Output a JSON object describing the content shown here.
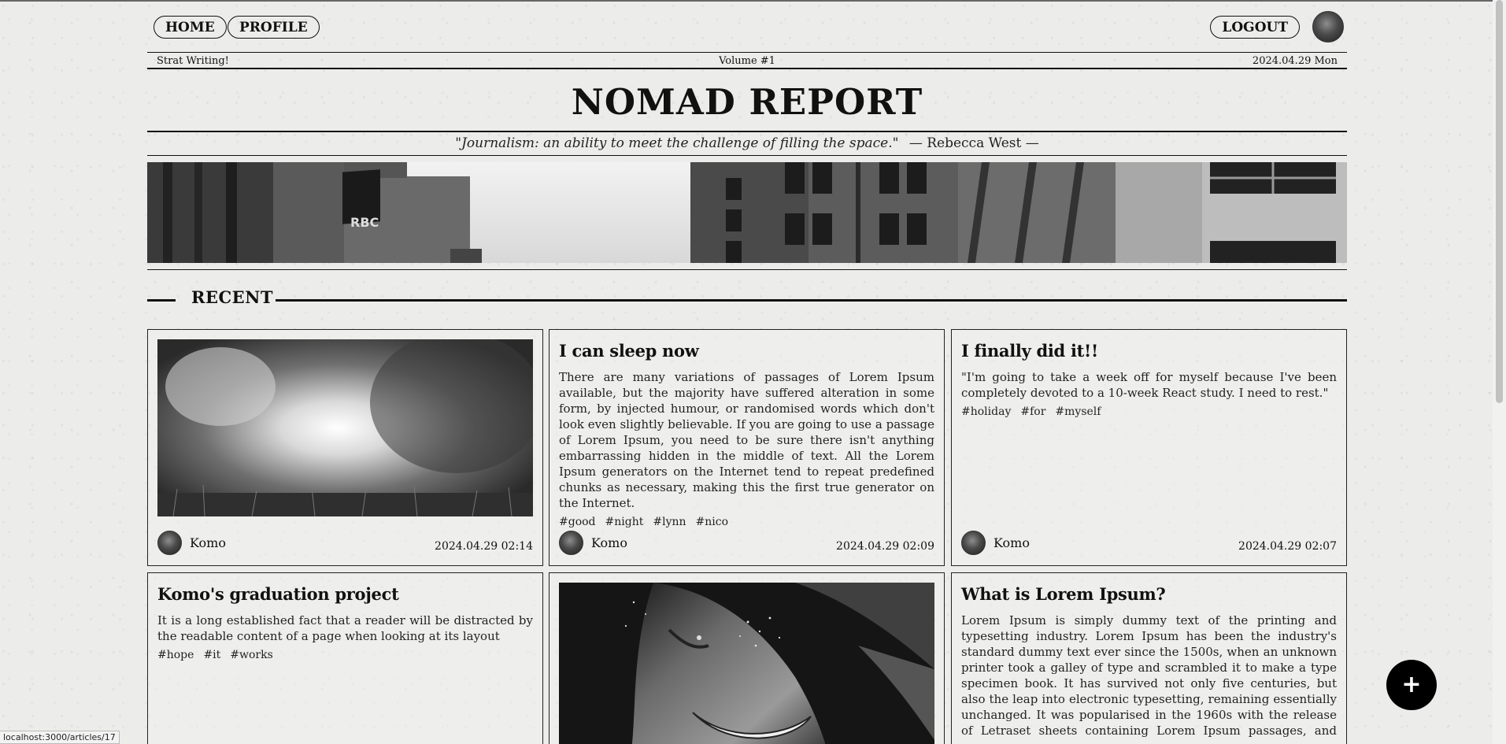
{
  "nav": {
    "home_label": "HOME",
    "profile_label": "PROFILE",
    "logout_label": "LOGOUT"
  },
  "infobar": {
    "left": "Strat Writing!",
    "center": "Volume #1",
    "right": "2024.04.29 Mon"
  },
  "masthead": {
    "title": "NOMAD REPORT",
    "quote": "\"Journalism: an ability to meet the challenge of filling the space.\"",
    "attribution": "— Rebecca West —"
  },
  "section": {
    "title": "RECENT"
  },
  "cards": [
    {
      "author": "Komo",
      "date": "2024.04.29 02:14"
    },
    {
      "title": "I can sleep now",
      "body": "There are many variations of passages of Lorem Ipsum available, but the majority have suffered alteration in some form, by injected humour, or randomised words which don't look even slightly believable. If you are going to use a passage of Lorem Ipsum, you need to be sure there isn't anything embarrassing hidden in the middle of text. All the Lorem Ipsum generators on the Internet tend to repeat predefined chunks as necessary, making this the first true generator on the Internet.",
      "tags": [
        "#good",
        "#night",
        "#lynn",
        "#nico"
      ],
      "author": "Komo",
      "date": "2024.04.29 02:09"
    },
    {
      "title": "I finally did it!!",
      "body": "\"I'm going to take a week off for myself because I've been completely devoted to a 10-week React study. I need to rest.\"",
      "tags": [
        "#holiday",
        "#for",
        "#myself"
      ],
      "author": "Komo",
      "date": "2024.04.29 02:07"
    },
    {
      "title": "Komo's graduation project",
      "body": "It is a long established fact that a reader will be distracted by the readable content of a page when looking at its layout",
      "tags": [
        "#hope",
        "#it",
        "#works"
      ]
    },
    {},
    {
      "title": "What is Lorem Ipsum?",
      "body": "Lorem Ipsum is simply dummy text of the printing and typesetting industry. Lorem Ipsum has been the industry's standard dummy text ever since the 1500s, when an unknown printer took a galley of type and scrambled it to make a type specimen book. It has survived not only five centuries, but also the leap into electronic typesetting, remaining essentially unchanged. It was popularised in the 1960s with the release of Letraset sheets containing Lorem Ipsum passages, and more"
    }
  ],
  "fab": {
    "label": "+"
  },
  "status": {
    "url": "localhost:3000/articles/17"
  }
}
